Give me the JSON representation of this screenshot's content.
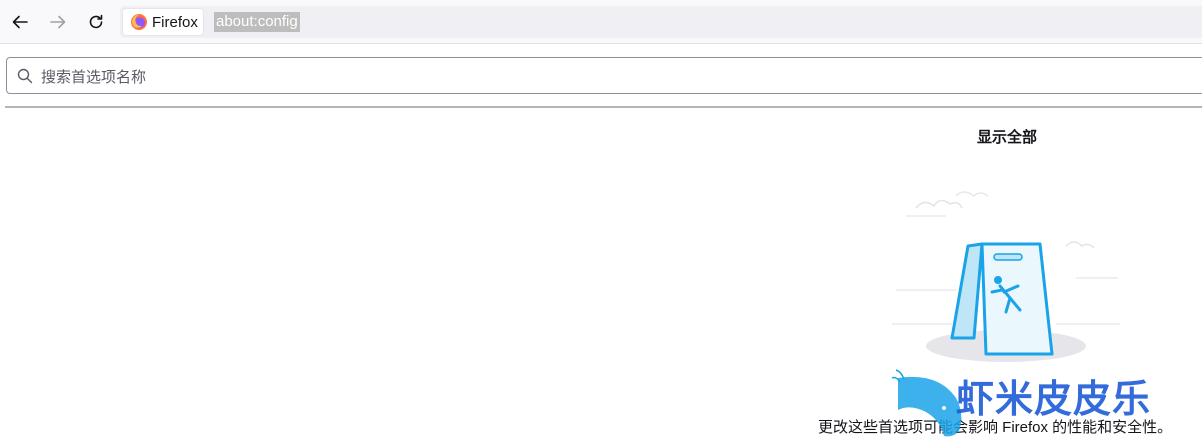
{
  "toolbar": {
    "identity_label": "Firefox",
    "url": "about:config"
  },
  "search": {
    "placeholder": "搜索首选项名称",
    "value": ""
  },
  "main": {
    "show_all_label": "显示全部",
    "warning_text": "更改这些首选项可能会影响 Firefox 的性能和安全性。"
  },
  "watermark": {
    "text": "虾米皮皮乐"
  },
  "icons": {
    "back": "arrow-left-icon",
    "forward": "arrow-right-icon",
    "reload": "reload-icon",
    "firefox": "firefox-logo-icon",
    "search": "search-icon"
  },
  "colors": {
    "accent_blue": "#1aa3e8",
    "watermark_blue": "#1e5bd8"
  }
}
